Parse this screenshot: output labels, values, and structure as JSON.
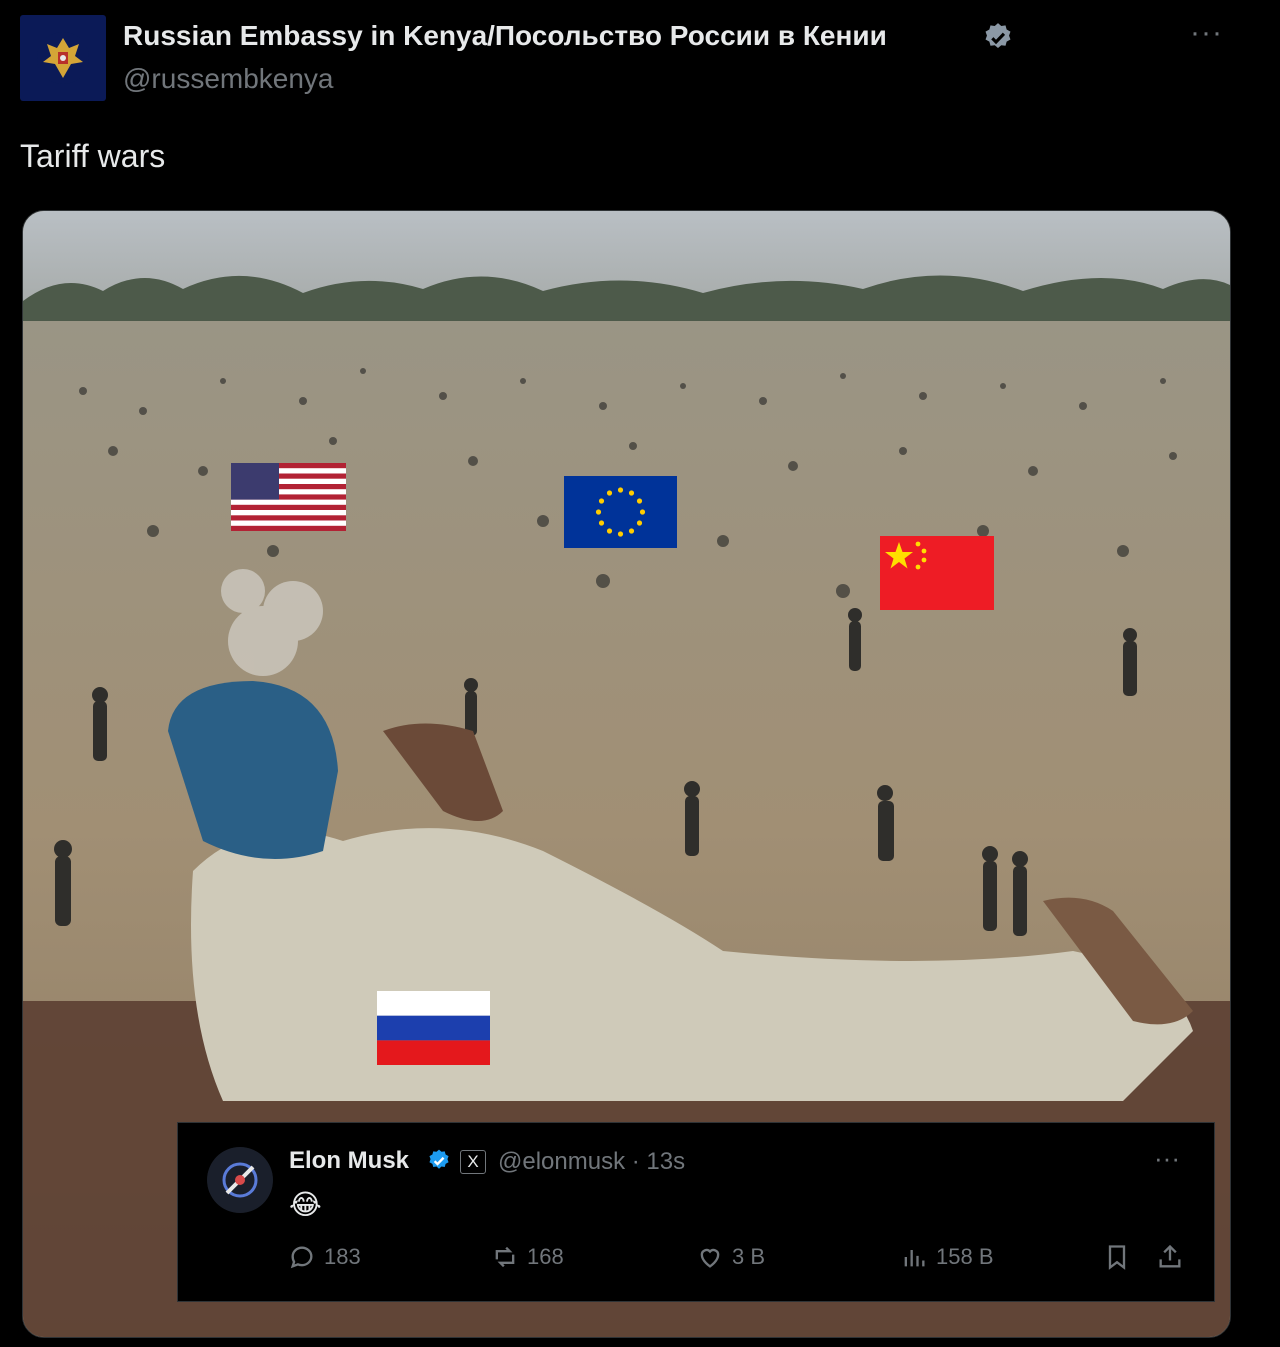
{
  "header": {
    "display_name": "Russian Embassy in Kenya/Посольство России в Кении",
    "handle": "@russembkenya",
    "more": "···"
  },
  "tweet": {
    "text": "Tariff wars"
  },
  "media": {
    "flags": [
      "flag-usa",
      "flag-eu",
      "flag-china",
      "flag-russia"
    ]
  },
  "quote": {
    "name": "Elon Musk",
    "x_badge": "X",
    "handle_time": "@elonmusk · 13s",
    "more": "···",
    "emoji": "😂",
    "replies": "183",
    "reposts": "168",
    "likes": "3 B",
    "views": "158 B"
  },
  "colors": {
    "background": "#000000",
    "text": "#e7e9ea",
    "muted": "#71767b",
    "verified": "#8b98a5",
    "quote_verified": "#1d9bf0"
  }
}
